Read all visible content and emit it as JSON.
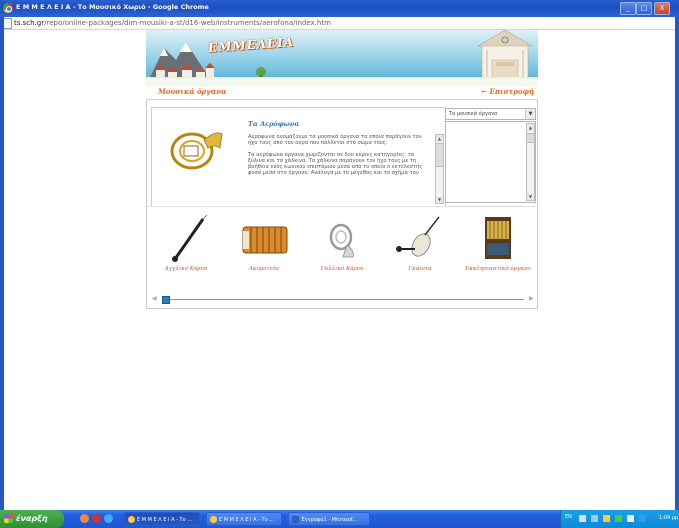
{
  "window": {
    "title": "Ε Μ Μ Ε Λ Ε Ι Α - Το Μουσικό Χωριό - Google Chrome",
    "controls": [
      "_",
      "□",
      "X"
    ]
  },
  "address_bar": {
    "host": "ts.sch.gr",
    "path": "/repo/online-packages/dim-mousiki-a-st/d16-web/instruments/aerofona/index.htm"
  },
  "page": {
    "brand": "ΕΜΜΕΛΕΙΑ",
    "section_title": "Μουσικά όργανα",
    "back_link": "← Επιστροφή",
    "info": {
      "title": "Τα Αερόφωνα",
      "paragraphs": [
        "Αερόφωνα ονομάζουμε τα μουσικά όργανα τα οποία παράγουν τον ήχο τους από τον αέρα που πάλλεται στο σώμα τους.",
        "Τα αερόφωνα όργανα χωρίζονται σε δύο κύριες κατηγορίες: τα ξύλινα και τα χάλκινα. Τα χάλκινα παράγουν τον ήχο τους με τη βοήθεια ενός κωνικού επιστόμιου μέσα από το οποίο ο εκτελεστής φυσά μέσα στο όργανο. Ανάλογα με το μέγεθος και το σχήμα του"
      ]
    },
    "dropdown": {
      "selected": "Τα μουσικά όργανα"
    },
    "instruments": [
      {
        "label": "Αγγλικό Κόρνο",
        "icon": "english-horn-icon"
      },
      {
        "label": "Ακορντεόν",
        "icon": "accordion-icon"
      },
      {
        "label": "Γαλλικό Κόρνο",
        "icon": "french-horn-icon"
      },
      {
        "label": "Γκάιντα",
        "icon": "bagpipe-icon"
      },
      {
        "label": "Εκκλησιαστικό όργανο",
        "icon": "church-organ-icon"
      }
    ],
    "slider": {
      "position": 0
    }
  },
  "taskbar": {
    "start_label": "έναρξη",
    "tasks": [
      {
        "label": "Ε Μ Μ Ε Λ Ε Ι Α - Το ...",
        "active": true
      },
      {
        "label": "Ε Μ Μ Ε Λ Ε Ι Α - Το ...",
        "active": false
      },
      {
        "label": "Έγγραφο1 - Microsof...",
        "active": false
      }
    ],
    "tray": {
      "language": "EN",
      "clock": "1:04 μμ"
    }
  },
  "colors": {
    "accent_orange": "#e06a1c",
    "title_blue": "#3a75b0",
    "taskbar_blue": "#245edc"
  }
}
